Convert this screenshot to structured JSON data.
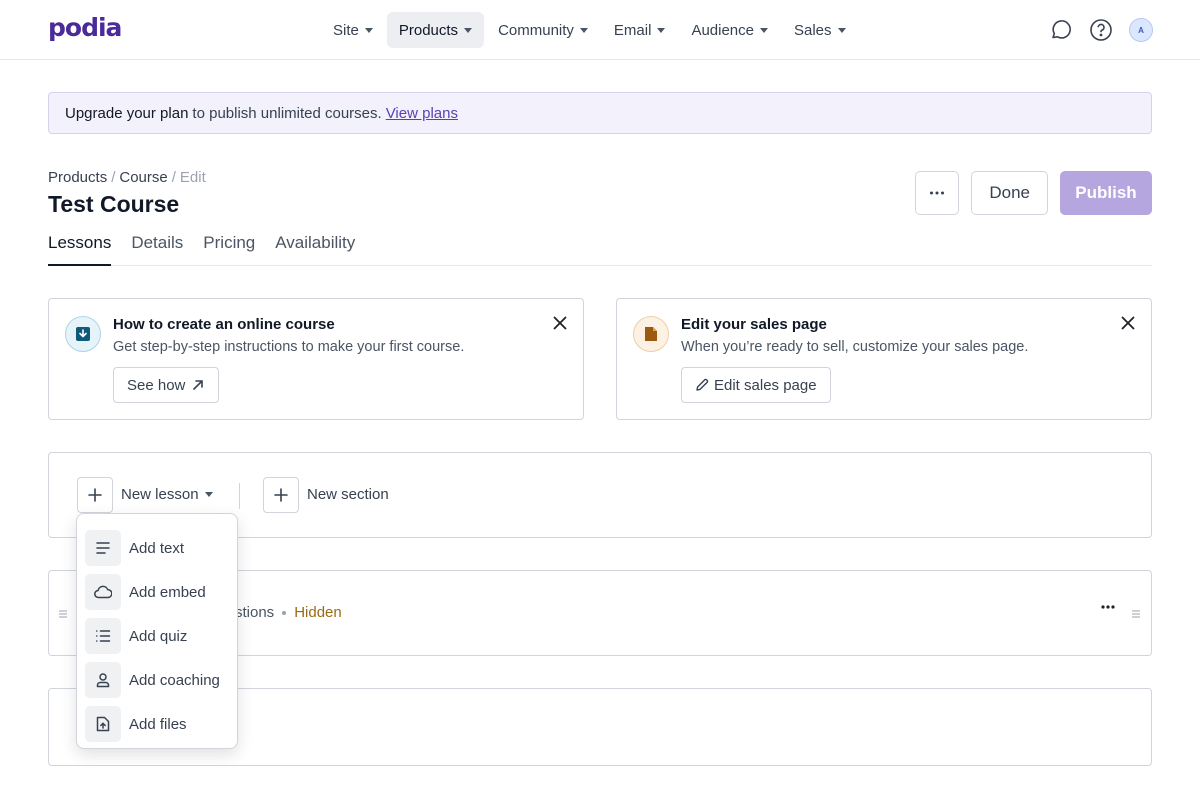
{
  "nav": {
    "logo": "podia",
    "items": [
      {
        "label": "Site",
        "active": false
      },
      {
        "label": "Products",
        "active": true
      },
      {
        "label": "Community",
        "active": false
      },
      {
        "label": "Email",
        "active": false
      },
      {
        "label": "Audience",
        "active": false
      },
      {
        "label": "Sales",
        "active": false
      }
    ],
    "avatar_initial": "A"
  },
  "banner": {
    "strong": "Upgrade your plan",
    "text": "to publish unlimited courses.",
    "link": "View plans"
  },
  "header": {
    "breadcrumb": [
      "Products",
      "Course",
      "Edit"
    ],
    "title": "Test Course",
    "more_icon": "ellipsis-icon",
    "done_label": "Done",
    "publish_label": "Publish"
  },
  "tabs": [
    "Lessons",
    "Details",
    "Pricing",
    "Availability"
  ],
  "cards": [
    {
      "title": "How to create an online course",
      "desc": "Get step-by-step instructions to make your first course.",
      "button": "See how",
      "icon": "download-icon",
      "accent": "#0e5a78"
    },
    {
      "title": "Edit your sales page",
      "desc": "When you’re ready to sell, customize your sales page.",
      "button": "Edit sales page",
      "icon": "document-icon",
      "accent": "#9a5b10"
    }
  ],
  "lessonbar": {
    "new_lesson": "New lesson",
    "new_section": "New section"
  },
  "row1": {
    "meta_partial": "stions",
    "status": "Hidden"
  },
  "dropdown": [
    {
      "label": "Add text",
      "icon": "text-lines-icon"
    },
    {
      "label": "Add embed",
      "icon": "cloud-icon"
    },
    {
      "label": "Add quiz",
      "icon": "list-icon"
    },
    {
      "label": "Add coaching",
      "icon": "person-icon"
    },
    {
      "label": "Add files",
      "icon": "file-upload-icon"
    }
  ],
  "colors": {
    "brand": "#4b2a99",
    "publish": "#b5a6e0",
    "banner_bg": "#f3f1fb",
    "hidden_status": "#9a6b12"
  }
}
